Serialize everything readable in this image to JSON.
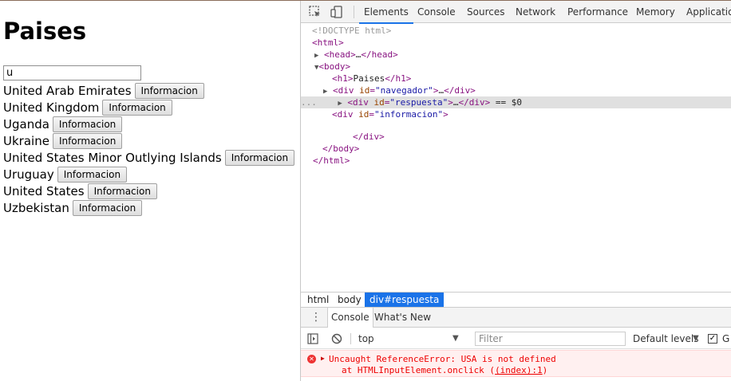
{
  "page": {
    "title": "Paises",
    "search_value": "u",
    "button_label": "Informacion",
    "countries": [
      "United Arab Emirates",
      "United Kingdom",
      "Uganda",
      "Ukraine",
      "United States Minor Outlying Islands",
      "Uruguay",
      "United States",
      "Uzbekistan"
    ]
  },
  "devtools": {
    "tabs": [
      "Elements",
      "Console",
      "Sources",
      "Network",
      "Performance",
      "Memory",
      "Applicatio"
    ],
    "active_tab": "Elements",
    "dom": {
      "doctype": "<!DOCTYPE html>",
      "html_open": "html",
      "head": "head",
      "head_ellipsis": "…",
      "body_open": "body",
      "h1_tag": "h1",
      "h1_text": "Paises",
      "div_tag": "div",
      "id_attr": "id",
      "navegador": "\"navegador\"",
      "respuesta": "\"respuesta\"",
      "informacion": "\"informacion\"",
      "selected_marker": "== $0",
      "gutter_dots": "..."
    },
    "breadcrumbs": [
      "html",
      "body",
      "div#respuesta"
    ],
    "drawer": {
      "tabs": [
        "Console",
        "What's New"
      ],
      "active_tab": "Console"
    },
    "console_bar": {
      "context": "top",
      "filter_placeholder": "Filter",
      "levels": "Default levels",
      "group_label": "G"
    },
    "error": {
      "message": "Uncaught ReferenceError: USA is not defined",
      "location_prefix": "at HTMLInputElement.onclick (",
      "location_link": "(index):1",
      "location_suffix": ")"
    }
  },
  "colors": {
    "accent": "#1a73e8",
    "error_text": "#ee0000",
    "error_bg": "#fff0f0",
    "tag": "#881280",
    "attr": "#994500",
    "value": "#1a1aa6"
  }
}
